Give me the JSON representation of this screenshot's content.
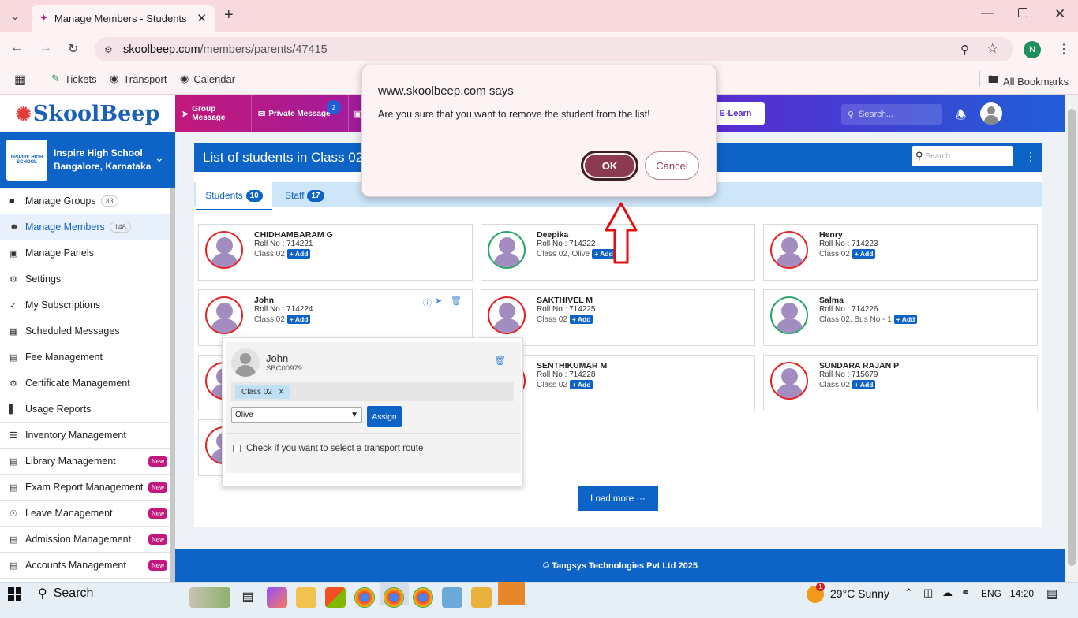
{
  "browser": {
    "tab_title": "Manage Members - Students",
    "url_domain": "skoolbeep.com",
    "url_path": "/members/parents/47415",
    "profile_initial": "N",
    "bookmarks": [
      "Tickets",
      "Transport",
      "Calendar"
    ],
    "all_bookmarks": "All Bookmarks"
  },
  "app": {
    "logo": "SkoolBeep",
    "nav": {
      "group_message": "Group Message",
      "private_message": "Private Message",
      "private_badge": "2",
      "elearn": "E-Learn",
      "search_placeholder": "Search..."
    },
    "school": {
      "name": "Inspire High School",
      "location": "Bangalore, Karnataka",
      "badge": "INSPIRE HIGH SCHOOL"
    }
  },
  "sidebar": {
    "items": [
      {
        "label": "Manage Groups",
        "count": "33"
      },
      {
        "label": "Manage Members",
        "count": "148"
      },
      {
        "label": "Manage Panels"
      },
      {
        "label": "Settings"
      },
      {
        "label": "My Subscriptions"
      },
      {
        "label": "Scheduled Messages"
      },
      {
        "label": "Fee Management"
      },
      {
        "label": "Certificate Management"
      },
      {
        "label": "Usage Reports"
      },
      {
        "label": "Inventory Management"
      },
      {
        "label": "Library Management",
        "badge": "New"
      },
      {
        "label": "Exam Report Management",
        "badge": "New"
      },
      {
        "label": "Leave Management",
        "badge": "New"
      },
      {
        "label": "Admission Management",
        "badge": "New"
      },
      {
        "label": "Accounts Management",
        "badge": "New"
      }
    ]
  },
  "main": {
    "title": "List of students in Class 02",
    "search_placeholder": "Search...",
    "tabs": [
      {
        "label": "Students",
        "count": "10"
      },
      {
        "label": "Staff",
        "count": "17"
      }
    ],
    "add_label": "+ Add",
    "students": [
      {
        "name": "CHIDHAMBARAM G",
        "roll": "Roll No : 714221",
        "cls": "Class 02",
        "ring": "red"
      },
      {
        "name": "Deepika",
        "roll": "Roll No : 714222",
        "cls": "Class 02, Olive",
        "ring": "green"
      },
      {
        "name": "Henry",
        "roll": "Roll No : 714223",
        "cls": "Class 02",
        "ring": "red"
      },
      {
        "name": "John",
        "roll": "Roll No : 714224",
        "cls": "Class 02",
        "ring": "red"
      },
      {
        "name": "SAKTHIVEL M",
        "roll": "Roll No : 714225",
        "cls": "Class 02",
        "ring": "red"
      },
      {
        "name": "Salma",
        "roll": "Roll No : 714226",
        "cls": "Class 02, Bus No - 1",
        "ring": "green"
      },
      {
        "name": "",
        "roll": "",
        "cls": "",
        "ring": "red"
      },
      {
        "name": "SENTHIKUMAR M",
        "roll": "Roll No : 714228",
        "cls": "Class 02",
        "ring": "red"
      },
      {
        "name": "SUNDARA RAJAN P",
        "roll": "Roll No : 715679",
        "cls": "Class 02",
        "ring": "red"
      },
      {
        "name": "",
        "roll": "",
        "cls": "",
        "ring": "red"
      }
    ],
    "popup": {
      "name": "John",
      "code": "SBC00979",
      "chip": "Class 02",
      "chip_remove": "X",
      "select_value": "Olive",
      "assign": "Assign",
      "transport_label": "Check if you want to select a transport route"
    },
    "load_more": "Load more ···",
    "footer": "© Tangsys Technologies Pvt Ltd 2025"
  },
  "dialog": {
    "origin": "www.skoolbeep.com says",
    "message": "Are you sure that you want to remove the student from the list!",
    "ok": "OK",
    "cancel": "Cancel"
  },
  "taskbar": {
    "search": "Search",
    "weather": "29°C  Sunny",
    "weather_badge": "1",
    "lang": "ENG",
    "time": "14:20"
  },
  "colors": {
    "primary": "#0d63c6",
    "accent": "#c2187b",
    "ok_button": "#8c3a4f",
    "annotation_arrow": "#e01010"
  }
}
